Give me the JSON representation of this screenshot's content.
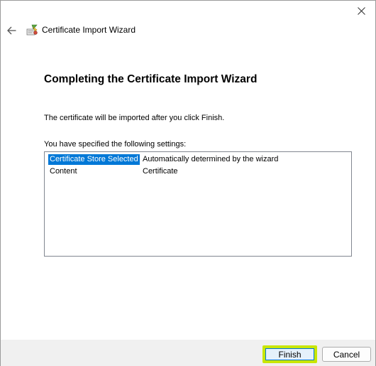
{
  "window": {
    "title": "Certificate Import Wizard",
    "close_icon": "close-icon",
    "back_icon": "back-arrow-icon",
    "wizard_icon": "certificate-wizard-icon"
  },
  "page": {
    "heading": "Completing the Certificate Import Wizard",
    "intro": "The certificate will be imported after you click Finish.",
    "settings_label": "You have specified the following settings:"
  },
  "settings": {
    "rows": [
      {
        "key": "Certificate Store Selected",
        "value": "Automatically determined by the wizard",
        "selected": true
      },
      {
        "key": "Content",
        "value": "Certificate",
        "selected": false
      }
    ]
  },
  "footer": {
    "finish_label": "Finish",
    "cancel_label": "Cancel",
    "highlight_color": "#c8e600"
  },
  "colors": {
    "selection": "#0078d7",
    "footer_bg": "#f0f0f0"
  }
}
